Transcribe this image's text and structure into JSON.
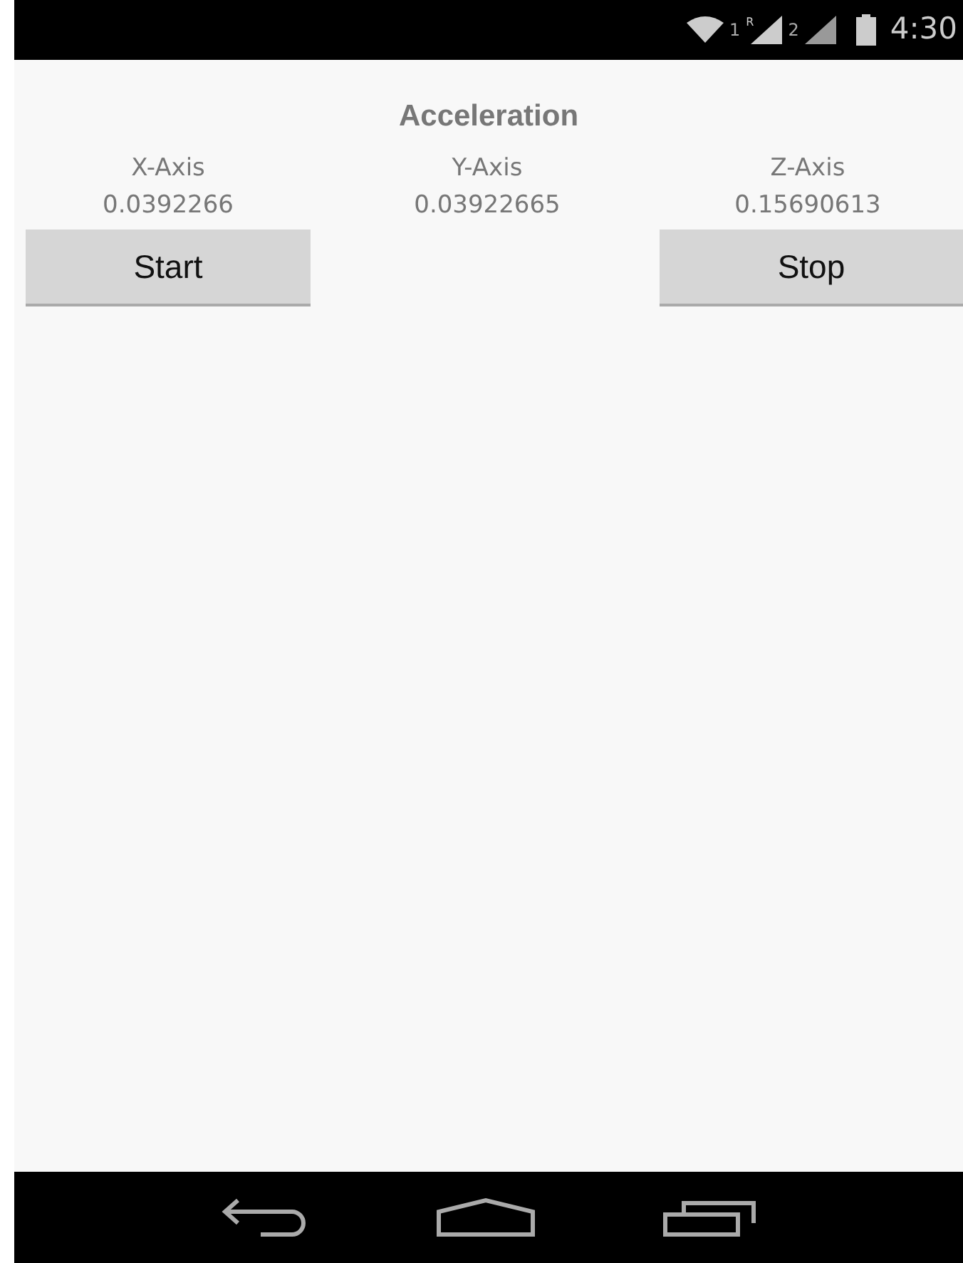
{
  "status_bar": {
    "sim_1": "1",
    "roaming": "R",
    "sim_2": "2",
    "time": "4:30"
  },
  "title": "Acceleration",
  "axes": [
    {
      "label": "X-Axis",
      "value": "0.0392266"
    },
    {
      "label": "Y-Axis",
      "value": "0.03922665"
    },
    {
      "label": "Z-Axis",
      "value": "0.15690613"
    }
  ],
  "buttons": [
    {
      "label": "Start"
    },
    {
      "label": "Stop"
    }
  ]
}
